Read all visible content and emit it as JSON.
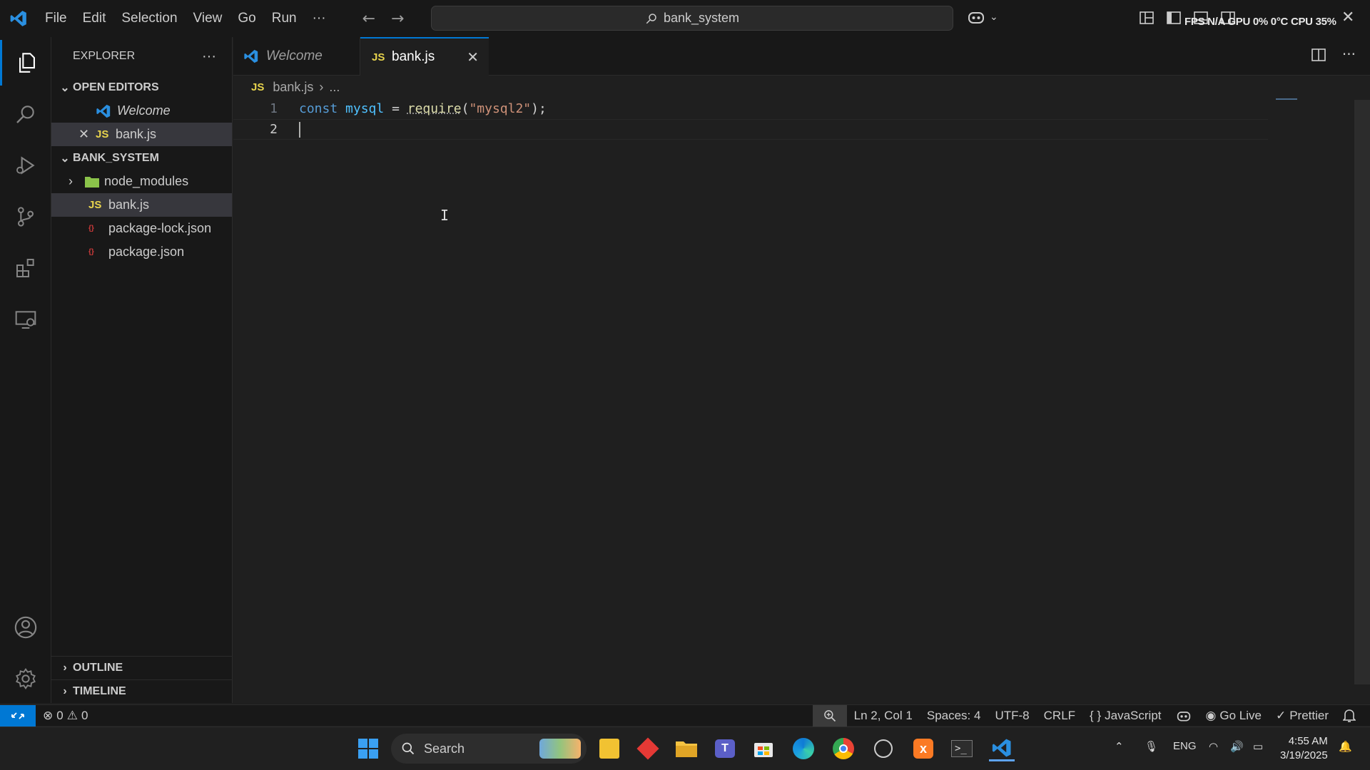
{
  "titlebar": {
    "menu": [
      "File",
      "Edit",
      "Selection",
      "View",
      "Go",
      "Run"
    ],
    "more": "···",
    "command_center": "bank_system",
    "perf_overlay": "FPS N/A GPU 0% 0°C CPU 35%"
  },
  "sidebar": {
    "header": "EXPLORER",
    "open_editors": {
      "title": "OPEN EDITORS",
      "items": [
        "Welcome",
        "bank.js"
      ]
    },
    "workspace": {
      "title": "BANK_SYSTEM",
      "items": [
        "node_modules",
        "bank.js",
        "package-lock.json",
        "package.json"
      ]
    },
    "outline": "OUTLINE",
    "timeline": "TIMELINE",
    "js_badge": "JS",
    "json_badge": "{}"
  },
  "tabs": [
    {
      "label": "Welcome"
    },
    {
      "label": "bank.js",
      "badge": "JS"
    }
  ],
  "breadcrumb": {
    "badge": "JS",
    "file": "bank.js",
    "rest": "..."
  },
  "editor": {
    "line_numbers": [
      "1",
      "2"
    ],
    "line1": {
      "kw": "const",
      "var": "mysql",
      "op": "=",
      "fn": "require",
      "open": "(",
      "str": "\"mysql2\"",
      "close": ");"
    }
  },
  "statusbar": {
    "errors": "0",
    "warnings": "0",
    "position": "Ln 2, Col 1",
    "spaces": "Spaces: 4",
    "encoding": "UTF-8",
    "eol": "CRLF",
    "language": "JavaScript",
    "golive": "Go Live",
    "prettier": "Prettier"
  },
  "taskbar": {
    "search": "Search",
    "lang": "ENG",
    "time": "4:55 AM",
    "date": "3/19/2025"
  },
  "colors": {
    "accent": "#0078d4",
    "js": "#e8d44d",
    "json": "#d13b3b"
  }
}
